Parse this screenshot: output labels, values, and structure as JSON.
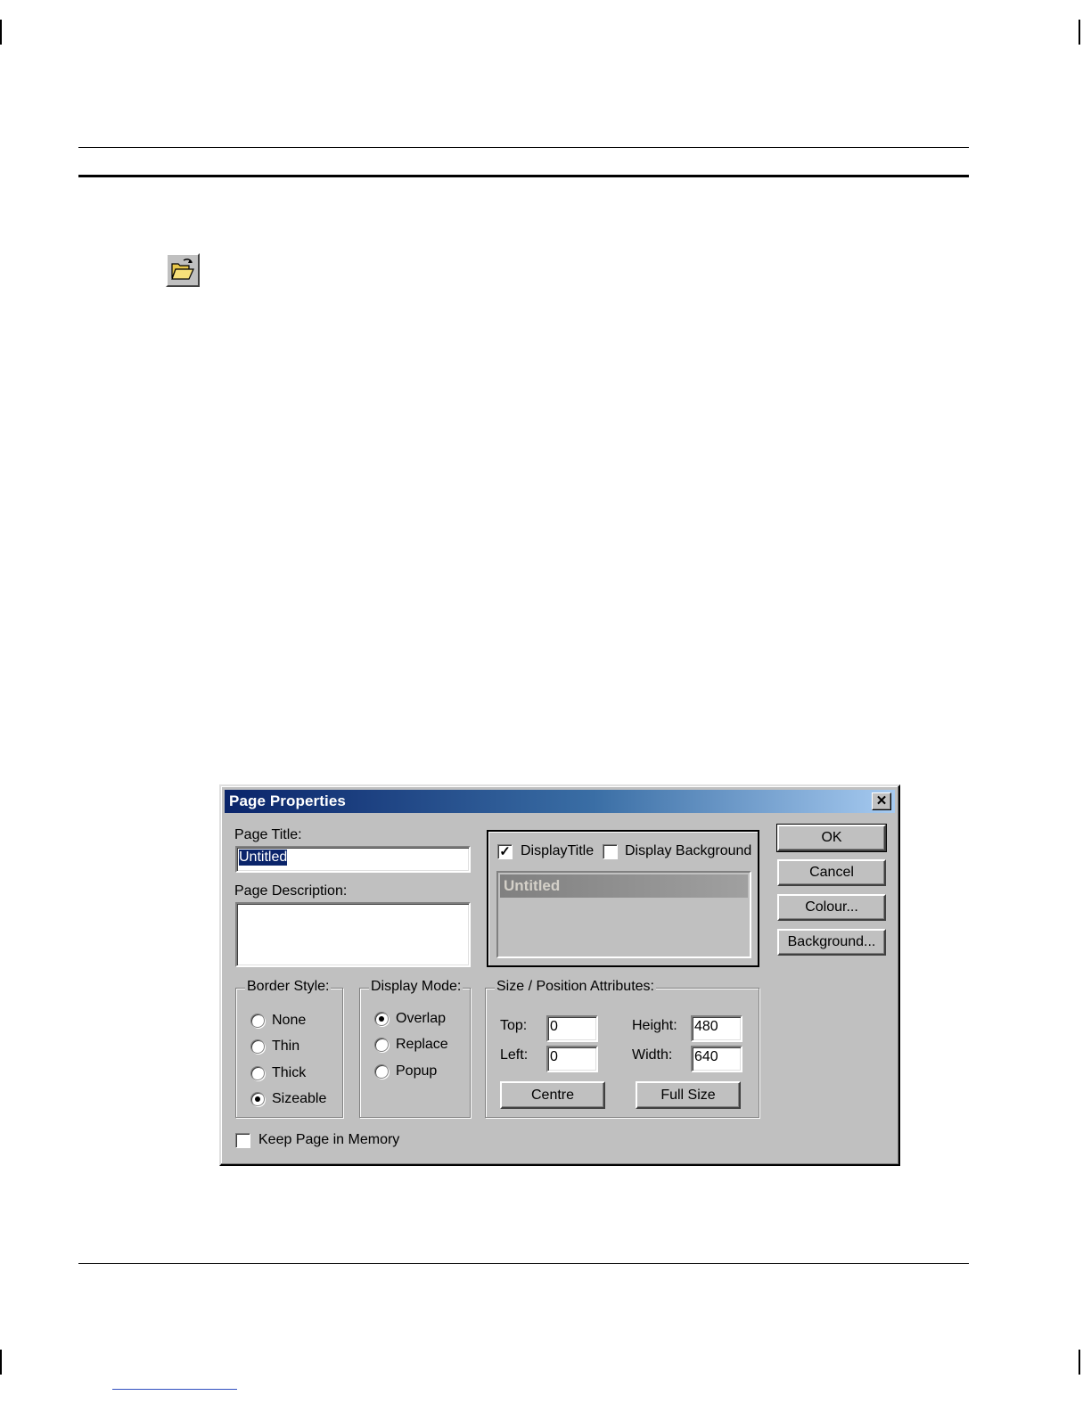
{
  "dialog": {
    "title": "Page Properties",
    "close_symbol": "✕",
    "page_title_label": "Page Title:",
    "page_title_value": "Untitled",
    "page_description_label": "Page Description:",
    "page_description_value": "",
    "display_title_label": "DisplayTitle",
    "display_title_checked": true,
    "display_background_label": "Display Background",
    "display_background_checked": false,
    "preview_title": "Untitled",
    "buttons": {
      "ok": "OK",
      "cancel": "Cancel",
      "colour": "Colour...",
      "background": "Background..."
    },
    "border_style": {
      "legend": "Border Style:",
      "options": [
        "None",
        "Thin",
        "Thick",
        "Sizeable"
      ],
      "selected": "Sizeable"
    },
    "display_mode": {
      "legend": "Display Mode:",
      "options": [
        "Overlap",
        "Replace",
        "Popup"
      ],
      "selected": "Overlap"
    },
    "size_position": {
      "legend": "Size / Position Attributes:",
      "top_label": "Top:",
      "top_value": "0",
      "left_label": "Left:",
      "left_value": "0",
      "height_label": "Height:",
      "height_value": "480",
      "width_label": "Width:",
      "width_value": "640",
      "centre_button": "Centre",
      "full_size_button": "Full Size"
    },
    "keep_in_memory_label": "Keep Page in Memory",
    "keep_in_memory_checked": false
  },
  "icons": {
    "toolbar_open": "folder-open-icon"
  },
  "colors": {
    "titlebar_start": "#0a246a",
    "titlebar_end": "#a6caf0",
    "dialog_face": "#c0c0c0",
    "selection": "#0a246a"
  }
}
